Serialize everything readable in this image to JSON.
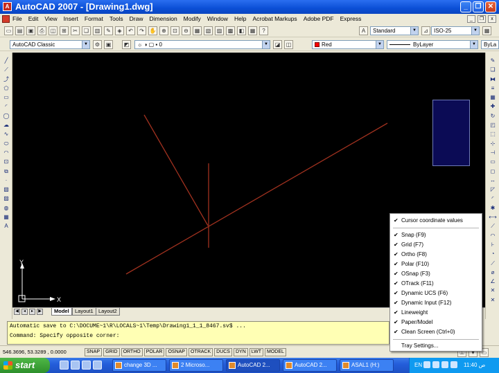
{
  "window": {
    "title": "AutoCAD 2007 - [Drawing1.dwg]"
  },
  "menu": [
    "File",
    "Edit",
    "View",
    "Insert",
    "Format",
    "Tools",
    "Draw",
    "Dimension",
    "Modify",
    "Window",
    "Help",
    "Acrobat Markups",
    "Adobe PDF",
    "Express"
  ],
  "toolbar": {
    "text_style": "Standard",
    "dim_style": "ISO-25",
    "workspace": "AutoCAD Classic",
    "layer": "0",
    "color": "Red",
    "linetype": "ByLayer",
    "lineweight": "ByLa"
  },
  "tabs": [
    "Model",
    "Layout1",
    "Layout2"
  ],
  "command": {
    "line1": "Automatic save to C:\\DOCUME~1\\R\\LOCALS~1\\Temp\\Drawing1_1_1_8467.sv$ ...",
    "line2": "Command: Specify opposite corner:"
  },
  "status": {
    "coords": "546.3696, 53.3289 , 0.0000",
    "buttons": [
      "SNAP",
      "GRID",
      "ORTHO",
      "POLAR",
      "OSNAP",
      "OTRACK",
      "DUCS",
      "DYN",
      "LWT",
      "MODEL"
    ]
  },
  "ucs": {
    "x": "X",
    "y": "Y"
  },
  "context_menu": {
    "header": "Cursor coordinate values",
    "items": [
      "Snap (F9)",
      "Grid (F7)",
      "Ortho (F8)",
      "Polar (F10)",
      "OSnap (F3)",
      "OTrack (F11)",
      "Dynamic UCS (F6)",
      "Dynamic Input (F12)",
      "Lineweight",
      "Paper/Model",
      "Clean Screen (Ctrl+0)"
    ],
    "footer": "Tray Settings..."
  },
  "taskbar": {
    "start": "start",
    "tasks": [
      "change 3D ...",
      "2 Microso...",
      "AutoCAD 2...",
      "AutoCAD 2...",
      "ASAL1 (H:)"
    ],
    "lang": "EN",
    "clock": "11:40 ص"
  },
  "colors": {
    "drawing_line": "#a0311f",
    "canvas": "#000000",
    "command_bg": "#ffffb4"
  }
}
